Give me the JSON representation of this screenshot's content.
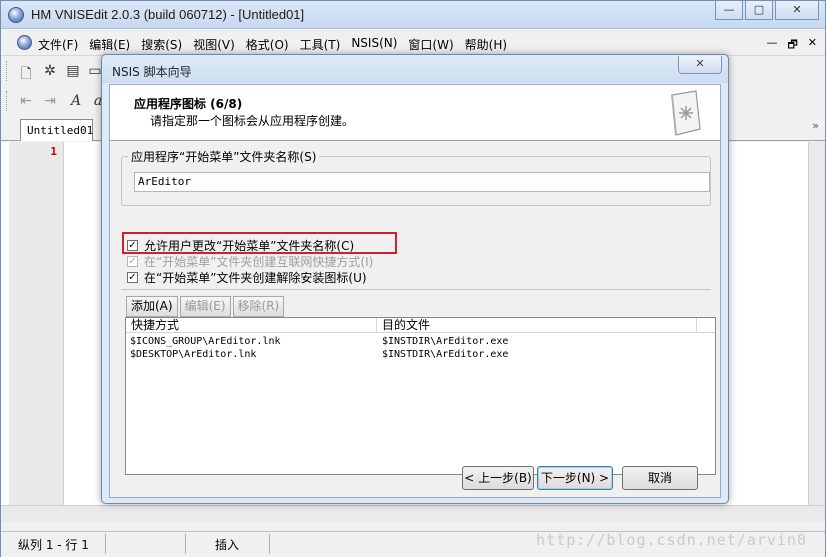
{
  "app": {
    "title": "HM VNISEdit 2.0.3 (build 060712) - [Untitled01]",
    "win_buttons": [
      "—",
      "□",
      "✕"
    ]
  },
  "menubar": {
    "items": [
      "文件(F)",
      "编辑(E)",
      "搜索(S)",
      "视图(V)",
      "格式(O)",
      "工具(T)",
      "NSIS(N)",
      "窗口(W)",
      "帮助(H)"
    ],
    "mdi_buttons": [
      "—",
      "🗗",
      "✕"
    ]
  },
  "tabs": {
    "active": "Untitled01"
  },
  "editor": {
    "line_number": "1"
  },
  "statusbar": {
    "position": "纵列 1 - 行 1",
    "mode": "插入",
    "watermark": "http://blog.csdn.net/arvin0"
  },
  "dialog": {
    "title": "NSIS 脚本向导",
    "close": "✕",
    "header_title": "应用程序图标 (6/8)",
    "header_subtitle": "请指定那一个图标会从应用程序创建。",
    "folder_group_label": "应用程序“开始菜单”文件夹名称(S)",
    "folder_value": "ArEditor",
    "checkboxes": [
      {
        "label": "允许用户更改“开始菜单”文件夹名称(C)",
        "checked": true,
        "enabled": true
      },
      {
        "label": "在“开始菜单”文件夹创建互联网快捷方式(I)",
        "checked": true,
        "enabled": false
      },
      {
        "label": "在“开始菜单”文件夹创建解除安装图标(U)",
        "checked": true,
        "enabled": true
      }
    ],
    "list_buttons": {
      "add": "添加(A)",
      "edit": "编辑(E)",
      "remove": "移除(R)"
    },
    "list_headers": [
      "快捷方式",
      "目的文件"
    ],
    "list_rows": [
      [
        "$ICONS_GROUP\\ArEditor.lnk",
        "$INSTDIR\\ArEditor.exe"
      ],
      [
        "$DESKTOP\\ArEditor.lnk",
        "$INSTDIR\\ArEditor.exe"
      ]
    ],
    "buttons": {
      "back": "< 上一步(B)",
      "next": "下一步(N) >",
      "cancel": "取消"
    }
  }
}
